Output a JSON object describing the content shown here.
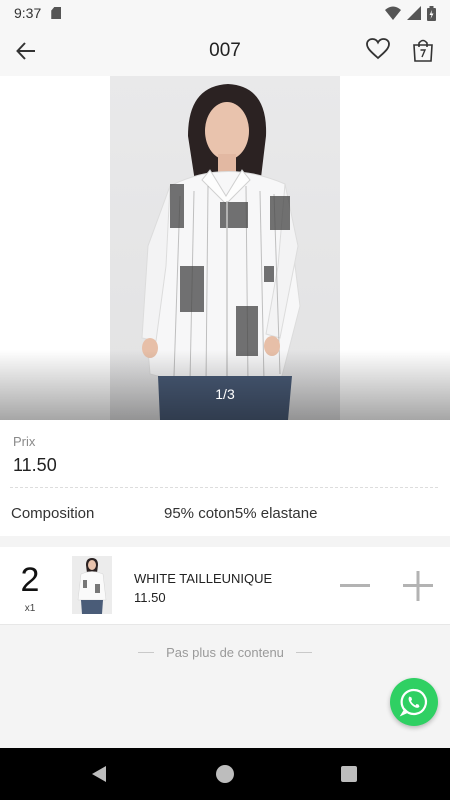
{
  "status": {
    "time": "9:37"
  },
  "header": {
    "title": "007"
  },
  "gallery": {
    "counter": "1/3"
  },
  "product": {
    "price_label": "Prix",
    "price": "11.50",
    "composition_label": "Composition",
    "composition_value": "95% coton5% elastane"
  },
  "cart": {
    "quantity": "2",
    "unit_qty": "x1",
    "item_name": "WHITE TAILLEUNIQUE",
    "item_price": "11.50"
  },
  "footer": {
    "end_text": "Pas plus de contenu"
  },
  "icons": {
    "back": "arrow-left-icon",
    "favorite": "heart-icon",
    "bag": "shopping-bag-icon",
    "whatsapp": "whatsapp-icon",
    "minus": "minus-icon",
    "plus": "plus-icon"
  },
  "colors": {
    "whatsapp": "#2fd063",
    "qty_controls": "#b3b3b3"
  }
}
